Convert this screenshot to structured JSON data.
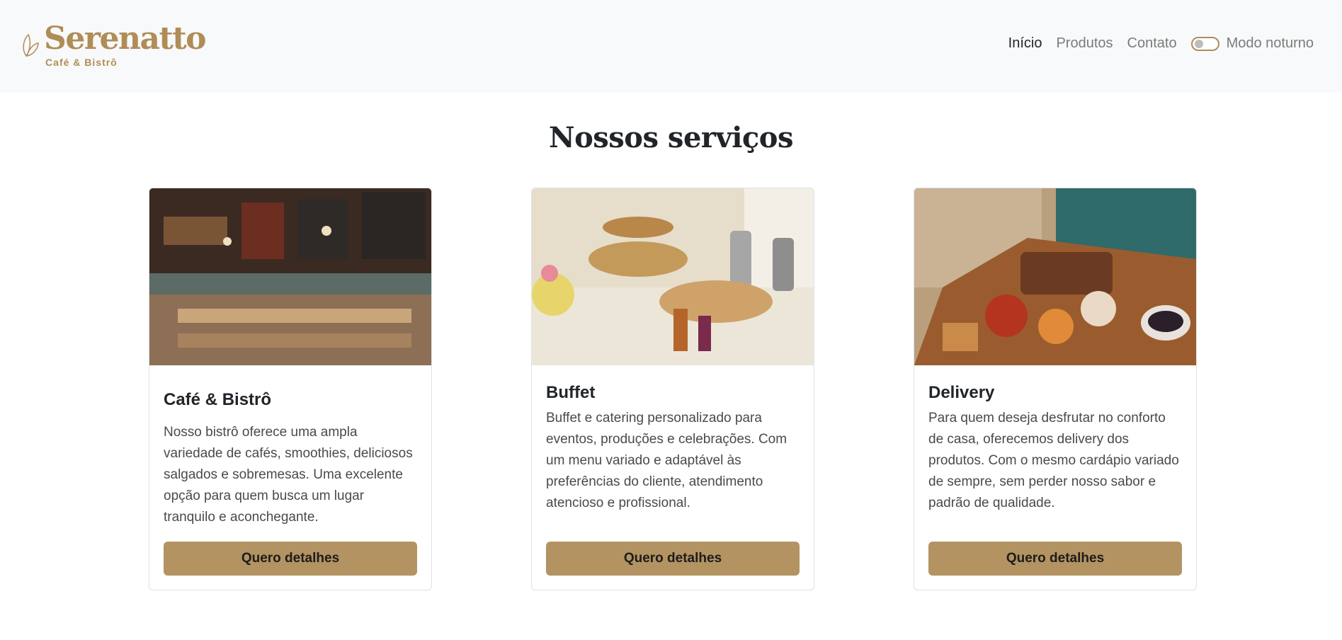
{
  "brand": {
    "name": "Serenatto",
    "subtitle": "Café & Bistrô",
    "color": "#b08d57",
    "icon": "leaf-logo-icon"
  },
  "nav": {
    "items": [
      {
        "label": "Início",
        "active": true
      },
      {
        "label": "Produtos",
        "active": false
      },
      {
        "label": "Contato",
        "active": false
      }
    ],
    "dark_mode_label": "Modo noturno",
    "dark_mode_on": false
  },
  "main": {
    "title": "Nossos serviços",
    "cards": [
      {
        "title": "Café & Bistrô",
        "text": "Nosso bistrô oferece uma ampla variedade de cafés, smoothies, deliciosos salgados e sobremesas. Uma excelente opção para quem busca um lugar tranquilo e aconchegante.",
        "button": "Quero detalhes",
        "image": "cafe-counter-photo"
      },
      {
        "title": "Buffet",
        "text": "Buffet e catering personalizado para eventos, produções e celebrações. Com um menu variado e adaptável às preferências do cliente, atendimento atencioso e profissional.",
        "button": "Quero detalhes",
        "image": "buffet-table-photo"
      },
      {
        "title": "Delivery",
        "text": "Para quem deseja desfrutar no conforto de casa, oferecemos delivery dos produtos. Com o mesmo cardápio variado de sempre, sem perder nosso sabor e padrão de qualidade.",
        "button": "Quero detalhes",
        "image": "delivery-box-photo"
      }
    ]
  },
  "colors": {
    "accent": "#b39361",
    "header_bg": "#f8f9fa"
  }
}
